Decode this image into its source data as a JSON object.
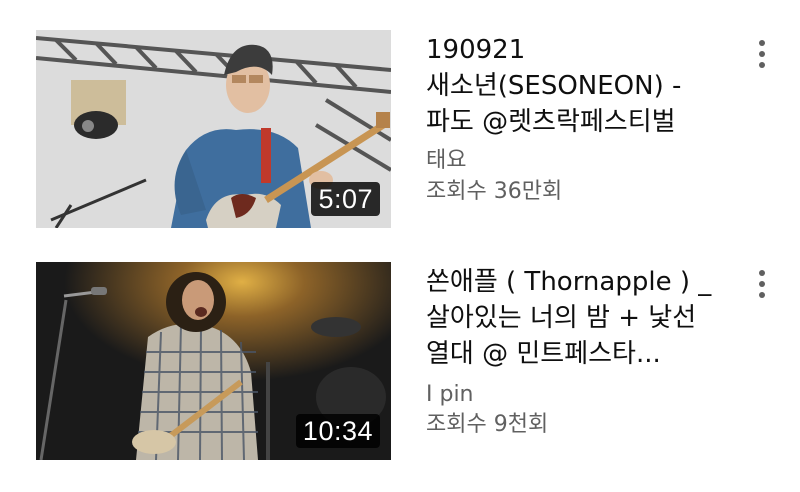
{
  "videos": [
    {
      "title": "190921\n새소년(SESONEON) -\n파도 @렛츠락페스티벌",
      "channel": "태요",
      "views": "조회수 36만회",
      "duration": "5:07",
      "thumbnail_icon": "guitarist-stage-thumbnail",
      "menu_icon": "more-vert-icon"
    },
    {
      "title": "쏜애플 ( Thornapple ) _\n살아있는 너의 밤 + 낯선\n열대 @ 민트페스타...",
      "channel": "I pin",
      "views": "조회수 9천회",
      "duration": "10:34",
      "thumbnail_icon": "guitarist-concert-thumbnail",
      "menu_icon": "more-vert-icon"
    }
  ],
  "colors": {
    "text_primary": "#0f0f0f",
    "text_secondary": "#606060",
    "duration_bg": "#000000"
  }
}
